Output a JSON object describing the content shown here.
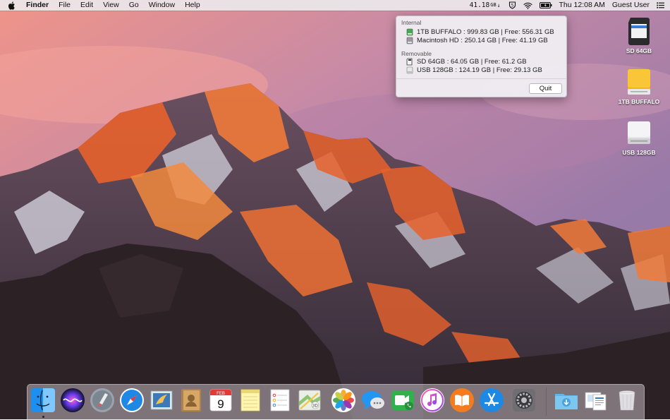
{
  "menubar": {
    "app_name": "Finder",
    "menus": [
      "File",
      "Edit",
      "View",
      "Go",
      "Window",
      "Help"
    ],
    "storage_value": "41.18",
    "storage_unit": "GB",
    "datetime": "Thu 12:08 AM",
    "user": "Guest User"
  },
  "panel": {
    "internal_title": "Internal",
    "internal_drives": [
      "1TB BUFFALO : 999.83 GB | Free: 556.31 GB",
      "Macintosh HD : 250.14 GB | Free: 41.19 GB"
    ],
    "removable_title": "Removable",
    "removable_drives": [
      "SD 64GB : 64.05 GB | Free: 61.2 GB",
      "USB 128GB : 124.19 GB | Free: 29.13 GB"
    ],
    "quit_label": "Quit"
  },
  "desktop": {
    "icons": [
      {
        "label": "SD 64GB",
        "icon": "sd-card-icon"
      },
      {
        "label": "1TB BUFFALO",
        "icon": "external-drive-icon"
      },
      {
        "label": "USB 128GB",
        "icon": "usb-drive-icon"
      }
    ]
  },
  "dock": {
    "apps": [
      "finder",
      "siri",
      "launchpad",
      "safari",
      "mail",
      "contacts",
      "calendar",
      "notes",
      "reminders",
      "maps",
      "photos",
      "messages",
      "facetime",
      "itunes",
      "ibooks",
      "app-store",
      "system-preferences",
      "downloads",
      "preview",
      "trash"
    ],
    "calendar_month": "FEB",
    "calendar_day": "9"
  },
  "colors": {
    "menubar_bg": "#ece8ec",
    "panel_bg": "#f0ecf2",
    "accent_orange": "#e8622c",
    "safari_blue": "#1e88e5"
  }
}
